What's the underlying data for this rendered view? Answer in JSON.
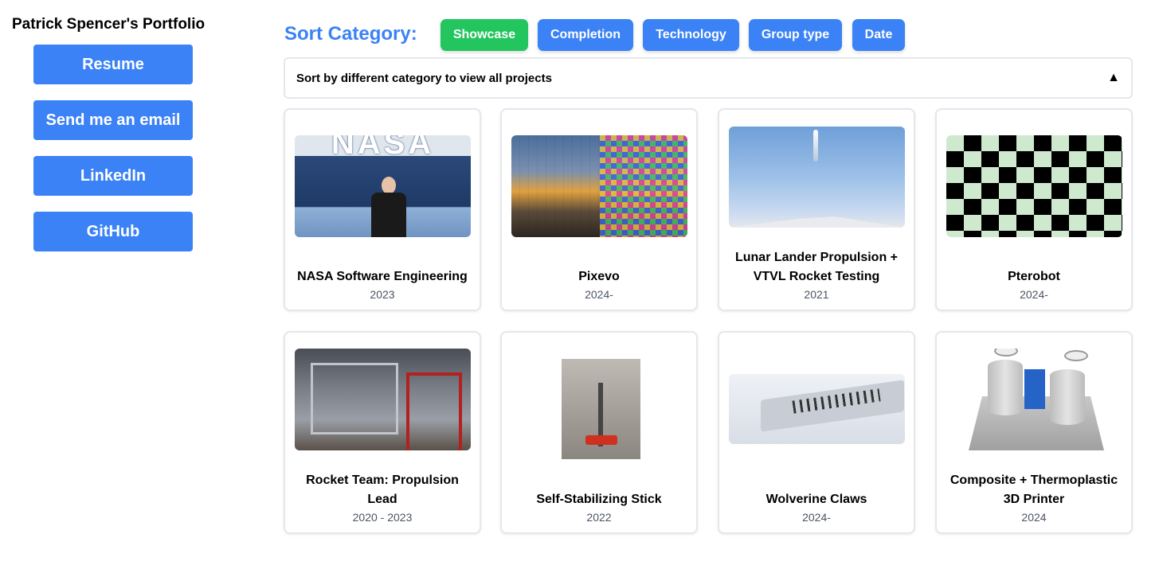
{
  "sidebar": {
    "title": "Patrick Spencer's Portfolio",
    "buttons": [
      "Resume",
      "Send me an email",
      "LinkedIn",
      "GitHub"
    ]
  },
  "sort": {
    "label": "Sort Category:",
    "options": [
      "Showcase",
      "Completion",
      "Technology",
      "Group type",
      "Date"
    ],
    "active": "Showcase",
    "dropdown_text": "Sort by different category to view all projects",
    "dropdown_arrow": "▲"
  },
  "projects": [
    {
      "title": "NASA Software Engineering",
      "date": "2023"
    },
    {
      "title": "Pixevo",
      "date": "2024-"
    },
    {
      "title": "Lunar Lander Propulsion + VTVL Rocket Testing",
      "date": "2021"
    },
    {
      "title": "Pterobot",
      "date": "2024-"
    },
    {
      "title": "Rocket Team: Propulsion Lead",
      "date": "2020 - 2023"
    },
    {
      "title": "Self-Stabilizing Stick",
      "date": "2022"
    },
    {
      "title": "Wolverine Claws",
      "date": "2024-"
    },
    {
      "title": "Composite + Thermoplastic 3D Printer",
      "date": "2024"
    }
  ],
  "images": {
    "nasa_wordmark": "NASA"
  },
  "colors": {
    "primary": "#3b82f6",
    "active": "#22c55e",
    "border": "#e5e7eb"
  }
}
